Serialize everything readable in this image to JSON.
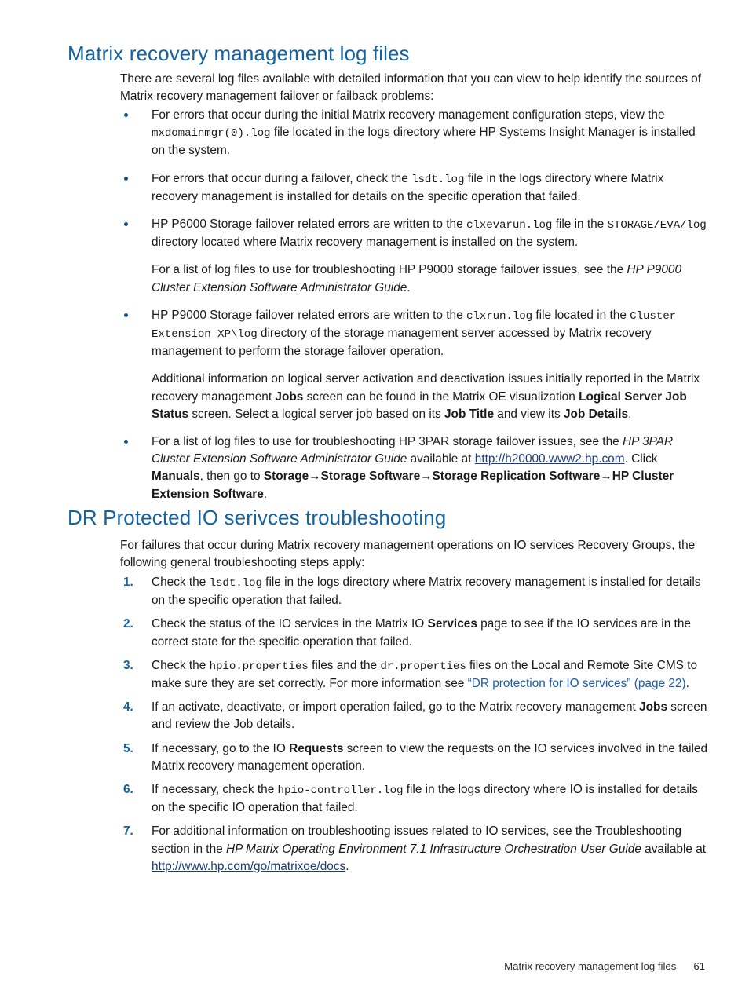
{
  "document": {
    "colors": {
      "heading_blue": "#14629e",
      "bullet_blue": "#14518c",
      "number_blue": "#14629e",
      "xref_link_blue": "#1b5ea8",
      "web_link_navy": "#1a3c79",
      "body_text": "#1a1a1a"
    }
  },
  "section1": {
    "heading": "Matrix recovery management log files",
    "intro": "There are several log files available with detailed information that you can view to help identify the sources of Matrix recovery management failover or failback problems:",
    "bullets": [
      {
        "id": "bullet-mxdomainmgr",
        "runs": [
          {
            "type": "text",
            "text": "For errors that occur during the initial Matrix recovery management configuration steps, view the "
          },
          {
            "type": "mono",
            "text": "mxdomainmgr(0).log"
          },
          {
            "type": "text",
            "text": " file located in the logs directory where HP Systems Insight Manager is installed on the system."
          }
        ]
      },
      {
        "id": "bullet-lsdt-log",
        "runs": [
          {
            "type": "text",
            "text": "For errors that occur during a failover, check the "
          },
          {
            "type": "mono",
            "text": "lsdt.log"
          },
          {
            "type": "text",
            "text": " file in the logs directory where Matrix recovery management is installed for details on the specific operation that failed."
          }
        ]
      },
      {
        "id": "bullet-p6000",
        "runs": [
          {
            "type": "text",
            "text": "HP P6000 Storage failover related errors are written to the "
          },
          {
            "type": "mono",
            "text": "clxevarun.log"
          },
          {
            "type": "text",
            "text": " file in the "
          },
          {
            "type": "mono",
            "text": "STORAGE/EVA/log"
          },
          {
            "type": "text",
            "text": " directory located where Matrix recovery management is installed on the system."
          }
        ],
        "sub_paragraphs": [
          {
            "id": "subpara-p9000-guide",
            "runs": [
              {
                "type": "text",
                "text": "For a list of log files to use for troubleshooting HP P9000 storage failover issues, see the "
              },
              {
                "type": "italic",
                "text": "HP P9000 Cluster Extension Software Administrator Guide"
              },
              {
                "type": "text",
                "text": "."
              }
            ]
          }
        ]
      },
      {
        "id": "bullet-p9000",
        "runs": [
          {
            "type": "text",
            "text": "HP P9000 Storage failover related errors are written to the "
          },
          {
            "type": "mono",
            "text": "clxrun.log"
          },
          {
            "type": "text",
            "text": " file located in the "
          },
          {
            "type": "mono",
            "text": "Cluster Extension XP\\log"
          },
          {
            "type": "text",
            "text": " directory of the storage management server accessed by Matrix recovery management to perform the storage failover operation."
          }
        ],
        "sub_paragraphs": [
          {
            "id": "subpara-logical-server-jobs",
            "runs": [
              {
                "type": "text",
                "text": "Additional information on logical server activation and deactivation issues initially reported in the Matrix recovery management "
              },
              {
                "type": "bold",
                "text": "Jobs"
              },
              {
                "type": "text",
                "text": " screen can be found in the Matrix OE visualization "
              },
              {
                "type": "bold",
                "text": "Logical Server Job Status"
              },
              {
                "type": "text",
                "text": " screen. Select a logical server job based on its "
              },
              {
                "type": "bold",
                "text": "Job Title"
              },
              {
                "type": "text",
                "text": " and view its "
              },
              {
                "type": "bold",
                "text": "Job Details"
              },
              {
                "type": "text",
                "text": "."
              }
            ]
          }
        ]
      },
      {
        "id": "bullet-3par",
        "runs": [
          {
            "type": "text",
            "text": "For a list of log files to use for troubleshooting HP 3PAR storage failover issues, see the "
          },
          {
            "type": "italic",
            "text": "HP 3PAR Cluster Extension Software Administrator Guide"
          },
          {
            "type": "text",
            "text": " available at "
          },
          {
            "type": "weblink",
            "text": "http://h20000.www2.hp.com"
          },
          {
            "type": "text",
            "text": ". Click "
          },
          {
            "type": "bold",
            "text": "Manuals"
          },
          {
            "type": "text",
            "text": ", then go to "
          },
          {
            "type": "bold",
            "text": "Storage"
          },
          {
            "type": "arrow",
            "text": "→"
          },
          {
            "type": "bold",
            "text": "Storage Software"
          },
          {
            "type": "arrow",
            "text": "→"
          },
          {
            "type": "bold",
            "text": "Storage Replication Software"
          },
          {
            "type": "arrow",
            "text": "→"
          },
          {
            "type": "bold",
            "text": "HP Cluster Extension Software"
          },
          {
            "type": "text",
            "text": "."
          }
        ]
      }
    ]
  },
  "section2": {
    "heading": "DR Protected IO serivces troubleshooting",
    "intro": "For failures that occur during Matrix recovery management operations on IO services Recovery Groups, the following general troubleshooting steps apply:",
    "steps": [
      {
        "id": "step-1",
        "marker": "1.",
        "runs": [
          {
            "type": "text",
            "text": "Check the "
          },
          {
            "type": "mono",
            "text": "lsdt.log"
          },
          {
            "type": "text",
            "text": " file in the logs directory where Matrix recovery management is installed for details on the specific operation that failed."
          }
        ]
      },
      {
        "id": "step-2",
        "marker": "2.",
        "runs": [
          {
            "type": "text",
            "text": "Check the status of the IO services in the Matrix IO "
          },
          {
            "type": "bold",
            "text": "Services"
          },
          {
            "type": "text",
            "text": " page to see if the IO services are in the correct state for the specific operation that failed."
          }
        ]
      },
      {
        "id": "step-3",
        "marker": "3.",
        "runs": [
          {
            "type": "text",
            "text": "Check the "
          },
          {
            "type": "mono",
            "text": "hpio.properties"
          },
          {
            "type": "text",
            "text": " files and the "
          },
          {
            "type": "mono",
            "text": "dr.properties"
          },
          {
            "type": "text",
            "text": " files on the Local and Remote Site CMS to make sure they are set correctly. For more information see "
          },
          {
            "type": "xref",
            "text": "“DR protection for IO services” (page 22)"
          },
          {
            "type": "text",
            "text": "."
          }
        ]
      },
      {
        "id": "step-4",
        "marker": "4.",
        "runs": [
          {
            "type": "text",
            "text": "If an activate, deactivate, or import operation failed, go to the Matrix recovery management "
          },
          {
            "type": "bold",
            "text": "Jobs"
          },
          {
            "type": "text",
            "text": " screen and review the Job details."
          }
        ]
      },
      {
        "id": "step-5",
        "marker": "5.",
        "runs": [
          {
            "type": "text",
            "text": "If necessary, go to the IO "
          },
          {
            "type": "bold",
            "text": "Requests"
          },
          {
            "type": "text",
            "text": " screen to view the requests on the IO services involved in the failed Matrix recovery management operation."
          }
        ]
      },
      {
        "id": "step-6",
        "marker": "6.",
        "runs": [
          {
            "type": "text",
            "text": "If necessary, check the "
          },
          {
            "type": "mono",
            "text": "hpio-controller.log"
          },
          {
            "type": "text",
            "text": " file in the logs directory where IO is installed for details on the specific IO operation that failed."
          }
        ]
      },
      {
        "id": "step-7",
        "marker": "7.",
        "runs": [
          {
            "type": "text",
            "text": "For additional information on troubleshooting issues related to IO services, see the Troubleshooting section in the "
          },
          {
            "type": "italic",
            "text": "HP Matrix Operating Environment 7.1 Infrastructure Orchestration User Guide"
          },
          {
            "type": "text",
            "text": "  available at "
          },
          {
            "type": "weblink",
            "text": "http://www.hp.com/go/matrixoe/docs"
          },
          {
            "type": "text",
            "text": "."
          }
        ]
      }
    ]
  },
  "footer": {
    "title": "Matrix recovery management log files",
    "page_number": "61"
  }
}
